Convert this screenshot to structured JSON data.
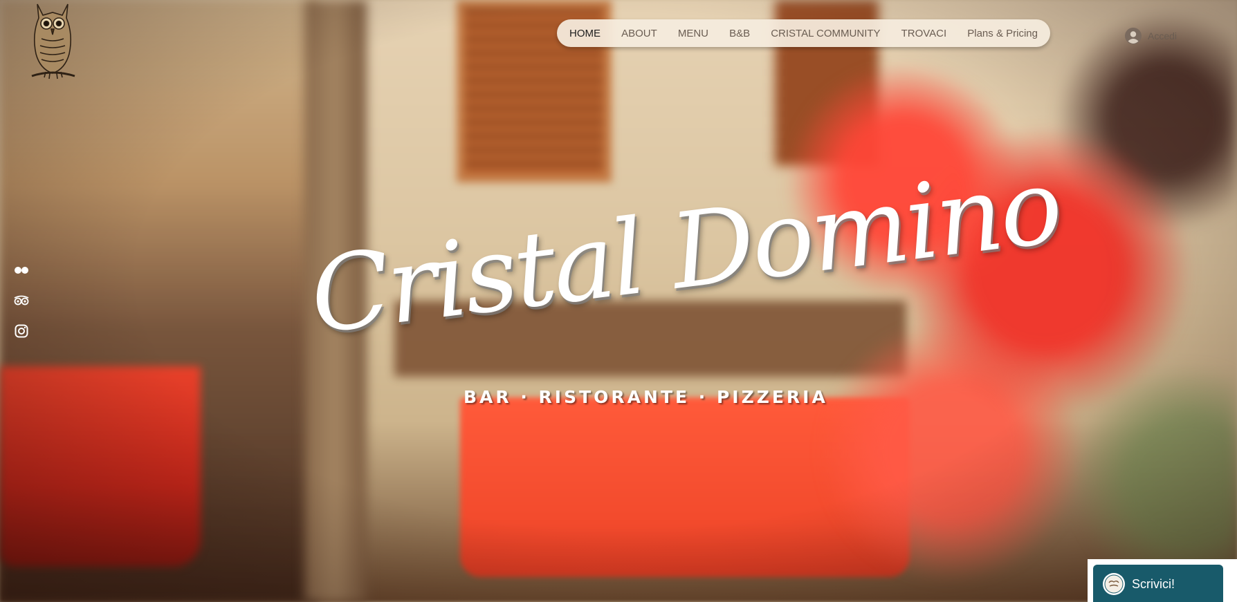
{
  "nav": {
    "items": [
      {
        "label": "HOME",
        "active": true
      },
      {
        "label": "ABOUT",
        "active": false
      },
      {
        "label": "MENU",
        "active": false
      },
      {
        "label": "B&B",
        "active": false
      },
      {
        "label": "CRISTAL COMMUNITY",
        "active": false
      },
      {
        "label": "TROVACI",
        "active": false
      },
      {
        "label": "Plans & Pricing",
        "active": false
      }
    ]
  },
  "login": {
    "label": "Accedi",
    "icon": "user-avatar-icon"
  },
  "logo": {
    "icon": "owl-logo"
  },
  "social": [
    {
      "name": "flickr",
      "icon": "flickr-icon"
    },
    {
      "name": "tripadvisor",
      "icon": "tripadvisor-icon"
    },
    {
      "name": "instagram",
      "icon": "instagram-icon"
    }
  ],
  "hero": {
    "title": "Cristal Domino",
    "subtitle": "BAR · RISTORANTE · PIZZERIA"
  },
  "chat": {
    "label": "Scrivici!",
    "icon": "cristal-domino-avatar"
  },
  "colors": {
    "nav_bg": "#f5ecde",
    "nav_text": "#6a5d52",
    "nav_active_text": "#1d1d1d",
    "chat_bg": "#185a6a",
    "title_color": "#ffffff"
  }
}
